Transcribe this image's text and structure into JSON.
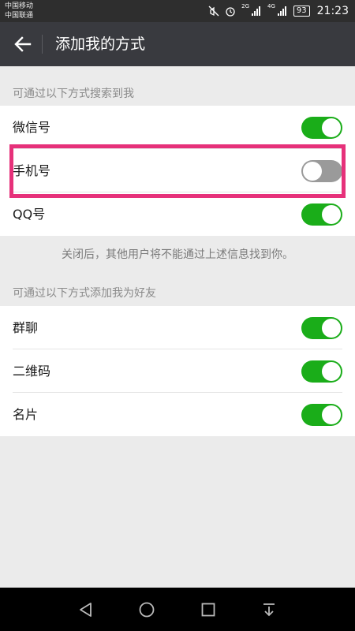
{
  "status_bar": {
    "carrier1": "中国移动",
    "carrier2": "中国联通",
    "net1": "2G",
    "net2": "4G",
    "battery": "93",
    "time": "21:23"
  },
  "header": {
    "title": "添加我的方式"
  },
  "search_section": {
    "header": "可通过以下方式搜索到我",
    "items": [
      {
        "label": "微信号",
        "enabled": true
      },
      {
        "label": "手机号",
        "enabled": false
      },
      {
        "label": "QQ号",
        "enabled": true
      }
    ],
    "note": "关闭后，其他用户将不能通过上述信息找到你。"
  },
  "add_section": {
    "header": "可通过以下方式添加我为好友",
    "items": [
      {
        "label": "群聊",
        "enabled": true
      },
      {
        "label": "二维码",
        "enabled": true
      },
      {
        "label": "名片",
        "enabled": true
      }
    ]
  },
  "colors": {
    "toggle_on": "#1aad19",
    "toggle_off": "#9a9a9a",
    "highlight": "#e6317a",
    "titlebar": "#393a3f"
  }
}
